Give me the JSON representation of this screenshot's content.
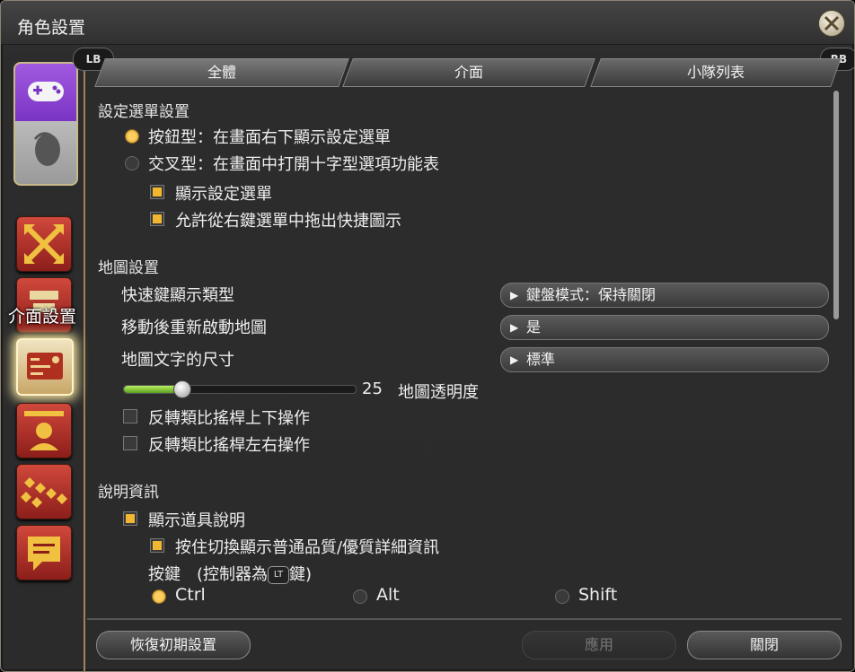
{
  "window": {
    "title": "角色設置"
  },
  "tooltip": "介面設置",
  "shoulder": {
    "left": "LB",
    "right": "RB"
  },
  "tabs": [
    {
      "label": "全體",
      "active": true
    },
    {
      "label": "介面",
      "active": false
    },
    {
      "label": "小隊列表",
      "active": false
    }
  ],
  "menu_section": {
    "title": "設定選單設置",
    "options": [
      {
        "label": "按鈕型：在畫面右下顯示設定選單",
        "selected": true
      },
      {
        "label": "交叉型：在畫面中打開十字型選項功能表",
        "selected": false
      }
    ],
    "checks": [
      {
        "label": "顯示設定選單",
        "checked": true
      },
      {
        "label": "允許從右鍵選單中拖出快捷圖示",
        "checked": true
      }
    ]
  },
  "map_section": {
    "title": "地圖設置",
    "settings": [
      {
        "label": "快速鍵顯示類型",
        "value": "鍵盤模式：保持關閉"
      },
      {
        "label": "移動後重新啟動地圖",
        "value": "是"
      },
      {
        "label": "地圖文字的尺寸",
        "value": "標準"
      }
    ],
    "opacity": {
      "value": "25",
      "label": "地圖透明度"
    },
    "checks": [
      {
        "label": "反轉類比搖桿上下操作",
        "checked": false
      },
      {
        "label": "反轉類比搖桿左右操作",
        "checked": false
      }
    ]
  },
  "info_section": {
    "title": "說明資訊",
    "show_item": {
      "label": "顯示道具說明",
      "checked": true
    },
    "hold_toggle": {
      "label": "按住切換顯示普通品質/優質詳細資訊",
      "checked": true
    },
    "key_prefix": "按鍵　(控制器為",
    "key_icon": "LT",
    "key_suffix": "鍵)",
    "keys": [
      {
        "label": "Ctrl",
        "selected": true
      },
      {
        "label": "Alt",
        "selected": false
      },
      {
        "label": "Shift",
        "selected": false
      }
    ]
  },
  "buttons": {
    "reset": "恢復初期設置",
    "apply": "應用",
    "close": "關閉"
  },
  "categories": [
    "controller-icon",
    "mouse-icon",
    "arrows-icon",
    "hud-icon",
    "interface-icon",
    "character-icon",
    "party-icon",
    "chat-icon"
  ]
}
